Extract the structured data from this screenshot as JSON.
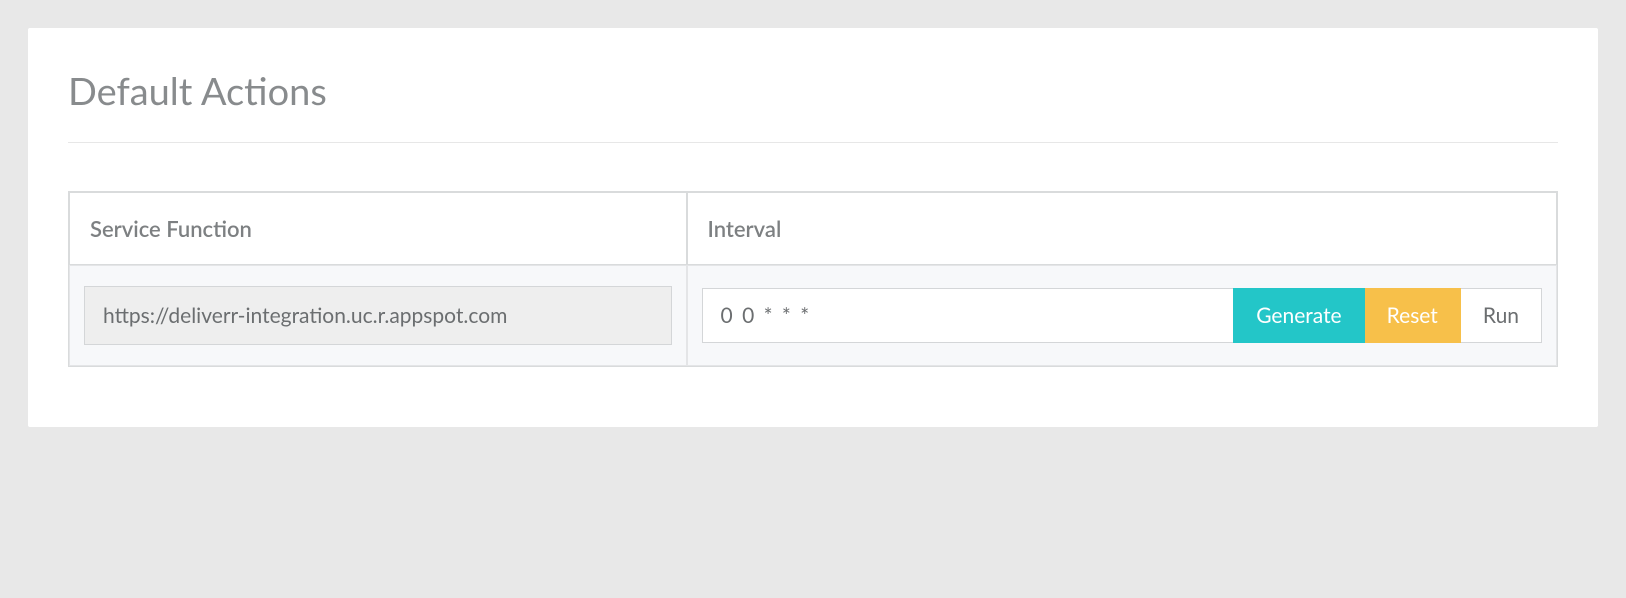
{
  "panel": {
    "title": "Default Actions"
  },
  "table": {
    "headers": {
      "service_function": "Service Function",
      "interval": "Interval"
    },
    "row": {
      "service_function_value": "https://deliverr-integration.uc.r.appspot.com",
      "interval_value": "0 0 * * *",
      "generate_label": "Generate",
      "reset_label": "Reset",
      "run_label": "Run"
    }
  }
}
